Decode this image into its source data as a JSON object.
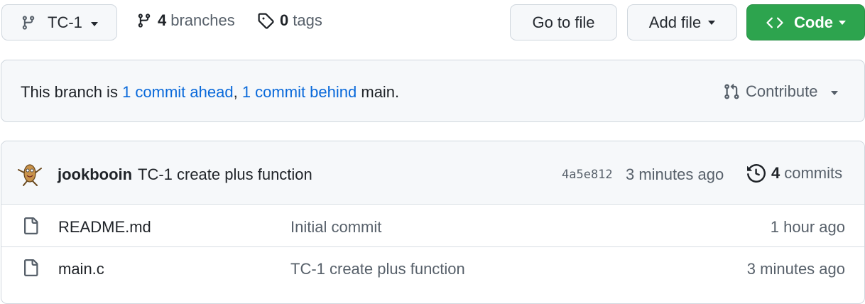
{
  "toolbar": {
    "branch_label": "TC-1",
    "branches_count": "4",
    "branches_label": "branches",
    "tags_count": "0",
    "tags_label": "tags",
    "go_to_file": "Go to file",
    "add_file": "Add file",
    "code": "Code"
  },
  "compare": {
    "prefix": "This branch is ",
    "ahead": "1 commit ahead",
    "comma": ", ",
    "behind": "1 commit behind",
    "suffix": " main.",
    "contribute": "Contribute"
  },
  "latest_commit": {
    "author": "jookbooin",
    "message": "TC-1 create plus function",
    "sha": "4a5e812",
    "time": "3 minutes ago",
    "commit_count": "4",
    "commits_label": "commits"
  },
  "files": [
    {
      "name": "README.md",
      "message": "Initial commit",
      "time": "1 hour ago"
    },
    {
      "name": "main.c",
      "message": "TC-1 create plus function",
      "time": "3 minutes ago"
    }
  ],
  "colors": {
    "code_button": "#2da44e",
    "link": "#0969da",
    "muted": "#57606a"
  },
  "icons": [
    "git-branch-icon",
    "caret-down-icon",
    "tag-icon",
    "code-icon",
    "git-pull-request-icon",
    "history-icon",
    "file-icon",
    "avatar"
  ]
}
